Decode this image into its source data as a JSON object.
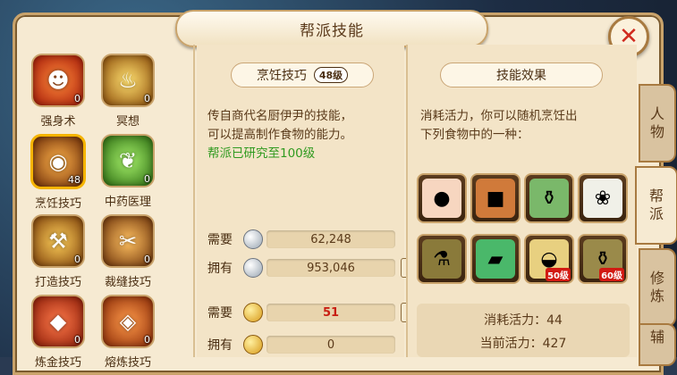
{
  "title": "帮派技能",
  "close_icon": "close-x-icon",
  "skills": [
    {
      "label": "强身术",
      "count": "0",
      "icon": "red-demon-icon"
    },
    {
      "label": "冥想",
      "count": "0",
      "icon": "meditation-icon"
    },
    {
      "label": "烹饪技巧",
      "count": "48",
      "icon": "cooking-pan-icon",
      "selected": true
    },
    {
      "label": "中药医理",
      "count": "0",
      "icon": "herb-leaf-icon"
    },
    {
      "label": "打造技巧",
      "count": "0",
      "icon": "anvil-icon"
    },
    {
      "label": "裁缝技巧",
      "count": "0",
      "icon": "needle-thread-icon"
    },
    {
      "label": "炼金技巧",
      "count": "0",
      "icon": "alchemy-crystal-icon"
    },
    {
      "label": "熔炼技巧",
      "count": "0",
      "icon": "smelting-gem-icon"
    }
  ],
  "detail": {
    "name": "烹饪技巧",
    "level": "48级",
    "desc_line1": "传自商代名厨伊尹的技能，",
    "desc_line2": "可以提高制作食物的能力。",
    "research": "帮派已研究至100级",
    "need_label": "需要",
    "have_label": "拥有",
    "silver_need": "62,248",
    "silver_have": "953,046",
    "gold_need": "51",
    "gold_have": "0",
    "plus_icon": "plus-icon",
    "info_icon": "info-icon"
  },
  "effect": {
    "header": "技能效果",
    "desc_line1": "消耗活力，你可以随机烹饪出",
    "desc_line2": "下列食物中的一种：",
    "foods": [
      {
        "icon": "steamed-bun-icon"
      },
      {
        "icon": "braised-meat-icon"
      },
      {
        "icon": "wine-jar-icon"
      },
      {
        "icon": "rice-ball-icon"
      },
      {
        "icon": "bronze-cauldron-icon"
      },
      {
        "icon": "green-cake-icon"
      },
      {
        "icon": "noodle-bowl-icon",
        "need": "50级"
      },
      {
        "icon": "bronze-vessel-icon",
        "need": "60级"
      }
    ],
    "cost": "消耗活力：44",
    "current": "当前活力：427"
  },
  "tabs": [
    {
      "label_top": "人",
      "label_bottom": "物"
    },
    {
      "label_top": "帮",
      "label_bottom": "派"
    },
    {
      "label_top": "修",
      "label_bottom": "炼"
    },
    {
      "label_top": "辅",
      "label_bottom": ""
    }
  ],
  "colors": {
    "accent": "#f5b400",
    "research_green": "#2f9a1f",
    "red_value": "#c81e12"
  }
}
